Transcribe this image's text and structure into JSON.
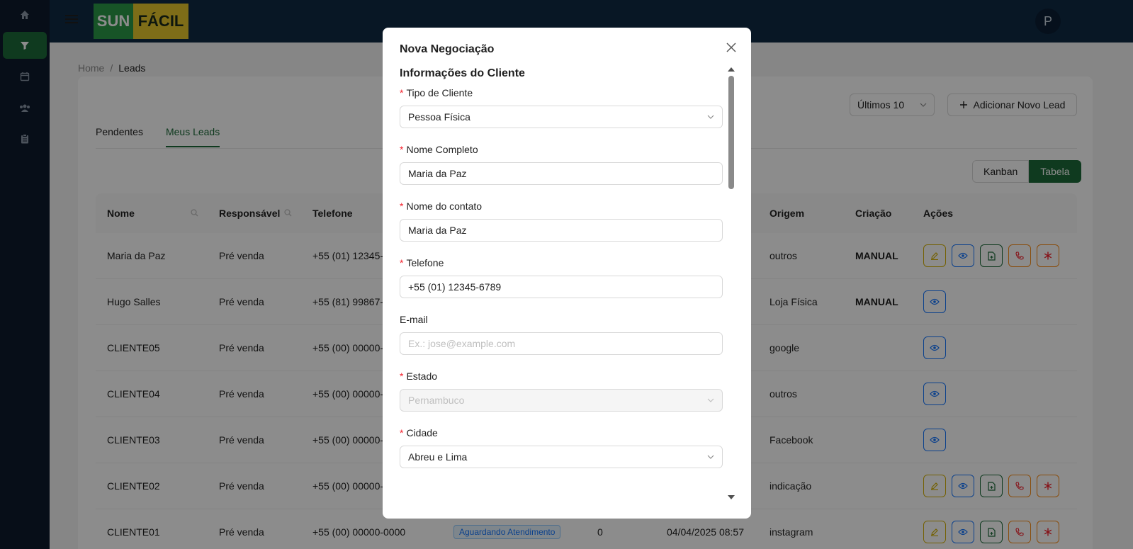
{
  "brand": {
    "part1": "SUN",
    "part2": "FÁCIL"
  },
  "user": {
    "initial": "P"
  },
  "breadcrumb": {
    "home": "Home",
    "sep": "/",
    "current": "Leads"
  },
  "tabs": [
    {
      "label": "Pendentes"
    },
    {
      "label": "Meus Leads"
    }
  ],
  "filter": {
    "value": "Últimos 10"
  },
  "add_lead": {
    "label": "Adicionar Novo Lead"
  },
  "view_toggle": {
    "kanban": "Kanban",
    "table": "Tabela"
  },
  "table": {
    "headers": {
      "name": "Nome",
      "owner": "Responsável",
      "phone": "Telefone",
      "origin": "Origem",
      "created": "Criação",
      "actions": "Ações"
    },
    "rows": [
      {
        "name": "Maria da Paz",
        "owner": "Pré venda",
        "phone": "+55 (01) 12345-",
        "origin": "outros",
        "created": "MANUAL"
      },
      {
        "name": "Hugo Salles",
        "owner": "Pré venda",
        "phone": "+55 (81) 99867-",
        "origin": "Loja Física",
        "created": "MANUAL"
      },
      {
        "name": "CLIENTE05",
        "owner": "Pré venda",
        "phone": "+55 (00) 00000-",
        "origin": "google",
        "created": ""
      },
      {
        "name": "CLIENTE04",
        "owner": "Pré venda",
        "phone": "+55 (00) 00000-",
        "origin": "outros",
        "created": ""
      },
      {
        "name": "CLIENTE03",
        "owner": "Pré venda",
        "phone": "+55 (00) 00000-",
        "origin": "Facebook",
        "created": ""
      },
      {
        "name": "CLIENTE02",
        "owner": "Pré venda",
        "phone": "+55 (00) 00000-",
        "origin": "indicação",
        "created": ""
      },
      {
        "name": "CLIENTE01",
        "owner": "Pré venda",
        "phone": "+55 (00) 00000-0000",
        "status": "Aguardando Atendimento",
        "count": "0",
        "date": "04/04/2025 08:57",
        "origin": "instagram",
        "created": ""
      }
    ]
  },
  "modal": {
    "title": "Nova Negociação",
    "section": "Informações do Cliente",
    "fields": {
      "client_type": {
        "label": "Tipo de Cliente",
        "value": "Pessoa Física"
      },
      "full_name": {
        "label": "Nome Completo",
        "value": "Maria da Paz"
      },
      "contact_name": {
        "label": "Nome do contato",
        "value": "Maria da Paz"
      },
      "phone": {
        "label": "Telefone",
        "value": "+55 (01) 12345-6789"
      },
      "email": {
        "label": "E-mail",
        "placeholder": "Ex.: jose@example.com"
      },
      "state": {
        "label": "Estado",
        "value": "Pernambuco"
      },
      "city": {
        "label": "Cidade",
        "value": "Abreu e Lima"
      }
    }
  },
  "colors": {
    "primary": "#1d6b39",
    "header": "#0f2a44",
    "sidebar": "#0e1a2c",
    "required": "#f5222d"
  }
}
